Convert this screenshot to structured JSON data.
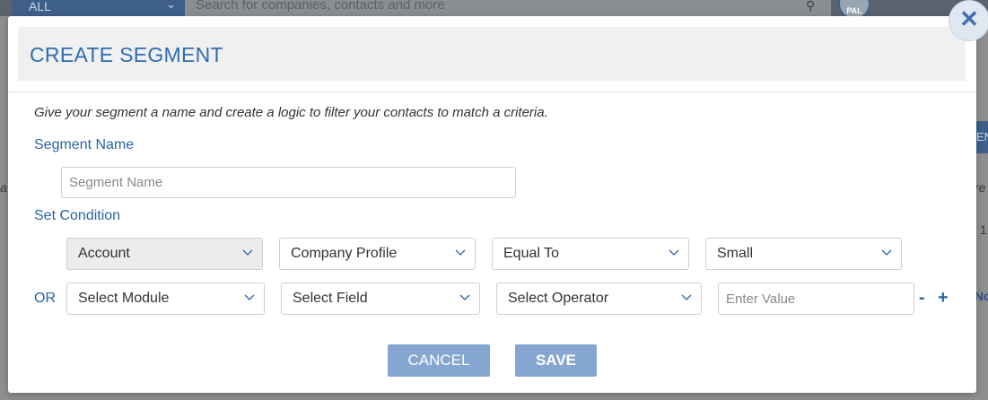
{
  "background": {
    "scope_label": "ALL",
    "search_placeholder": "Search for companies, contacts and more",
    "avatar_initials": "PAL",
    "strip_text": "EN",
    "fragments": [
      "a",
      "re",
      "1",
      "No"
    ]
  },
  "modal": {
    "title": "CREATE SEGMENT",
    "instructions": "Give your segment a name and create a logic to filter your contacts to match a criteria.",
    "segment_name_label": "Segment Name",
    "segment_name_placeholder": "Segment Name",
    "segment_name_value": "",
    "set_condition_label": "Set Condition",
    "conditions": [
      {
        "module": "Account",
        "field": "Company Profile",
        "operator": "Equal To",
        "value": "Small"
      },
      {
        "connector": "OR",
        "module": "Select Module",
        "field": "Select Field",
        "operator": "Select Operator",
        "value_placeholder": "Enter Value"
      }
    ],
    "remove_label": "-",
    "add_label": "+",
    "cancel_label": "CANCEL",
    "save_label": "SAVE",
    "close_icon": "close-icon"
  },
  "colors": {
    "accent": "#2f6db1",
    "button": "#86a6d2",
    "header_bg": "#f0f0f0"
  }
}
